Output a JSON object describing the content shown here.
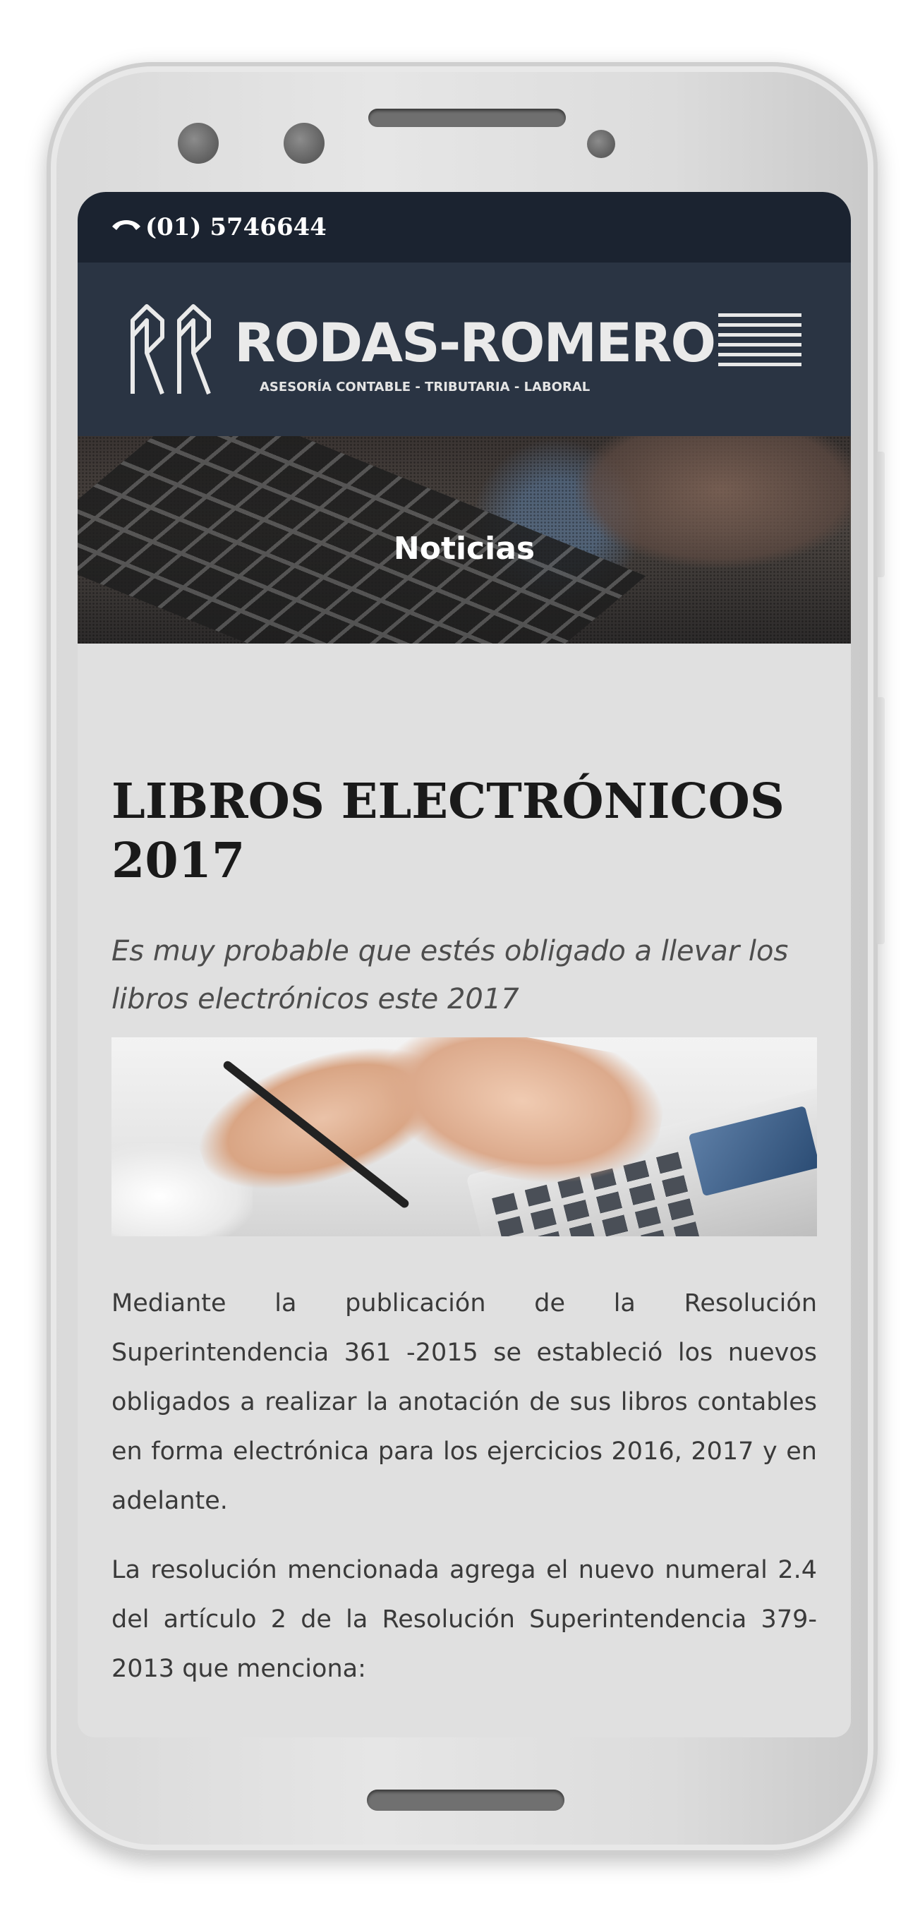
{
  "topbar": {
    "phone": "(01) 5746644"
  },
  "brand": {
    "name": "RODAS-ROMERO",
    "tagline": "ASESORÍA CONTABLE - TRIBUTARIA - LABORAL"
  },
  "hero": {
    "title": "Noticias"
  },
  "article": {
    "title": "LIBROS ELECTRÓNICOS 2017",
    "subtitle": "Es muy probable que estés obligado a llevar los libros electrónicos este 2017",
    "paragraphs": [
      "Mediante la publicación de la Resolución Superintendencia 361 -2015 se estableció los nuevos obligados a realizar la anotación de sus libros contables en forma electrónica para los ejercicios 2016, 2017 y en adelante.",
      "La resolución mencionada agrega el nuevo numeral 2.4 del artículo 2 de la Resolución Superintendencia 379-2013 que menciona:"
    ]
  },
  "icons": {
    "phone": "phone-handset-icon",
    "menu": "hamburger-menu-icon",
    "logo": "rr-logo-icon"
  },
  "colors": {
    "topbar": "#1b2330",
    "header": "#2a3443",
    "background": "#e0e0e0",
    "text": "#3a3a3a",
    "title": "#1a1a1a"
  }
}
